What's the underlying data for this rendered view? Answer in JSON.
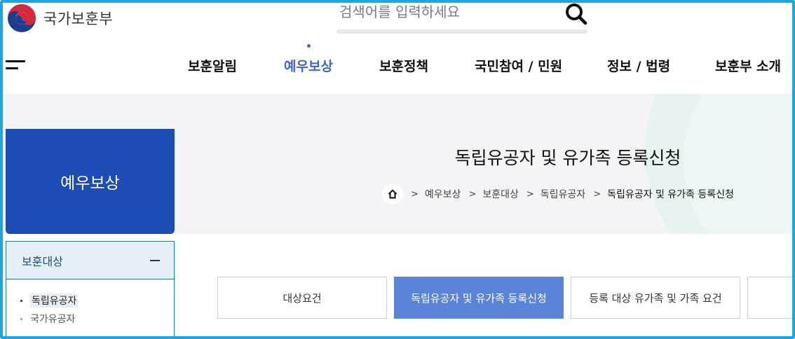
{
  "header": {
    "logo_text": "국가보훈부",
    "search_placeholder": "검색어를 입력하세요"
  },
  "nav": {
    "items": [
      {
        "label": "보훈알림",
        "active": false
      },
      {
        "label": "예우보상",
        "active": true
      },
      {
        "label": "보훈정책",
        "active": false
      },
      {
        "label": "국민참여 / 민원",
        "active": false
      },
      {
        "label": "정보 / 법령",
        "active": false
      },
      {
        "label": "보훈부 소개",
        "active": false
      }
    ]
  },
  "banner": {
    "page_title": "독립유공자 및 유가족 등록신청",
    "breadcrumb": [
      "예우보상",
      "보훈대상",
      "독립유공자",
      "독립유공자 및 유가족 등록신청"
    ]
  },
  "sidebar": {
    "title": "예우보상",
    "section_label": "보훈대상",
    "items": [
      {
        "label": "독립유공자",
        "active": true
      },
      {
        "label": "국가유공자",
        "active": false
      }
    ]
  },
  "tabs": [
    {
      "label": "대상요건",
      "active": false
    },
    {
      "label": "독립유공자 및 유가족 등록신청",
      "active": true
    },
    {
      "label": "등록 대상 유가족 및 가족 요건",
      "active": false
    },
    {
      "label": "",
      "active": false
    }
  ],
  "colors": {
    "accent": "#3f66c6",
    "sidebar_box": "#1d4db4",
    "active_tab": "#5a84d8",
    "frame": "#1ea6e0"
  }
}
